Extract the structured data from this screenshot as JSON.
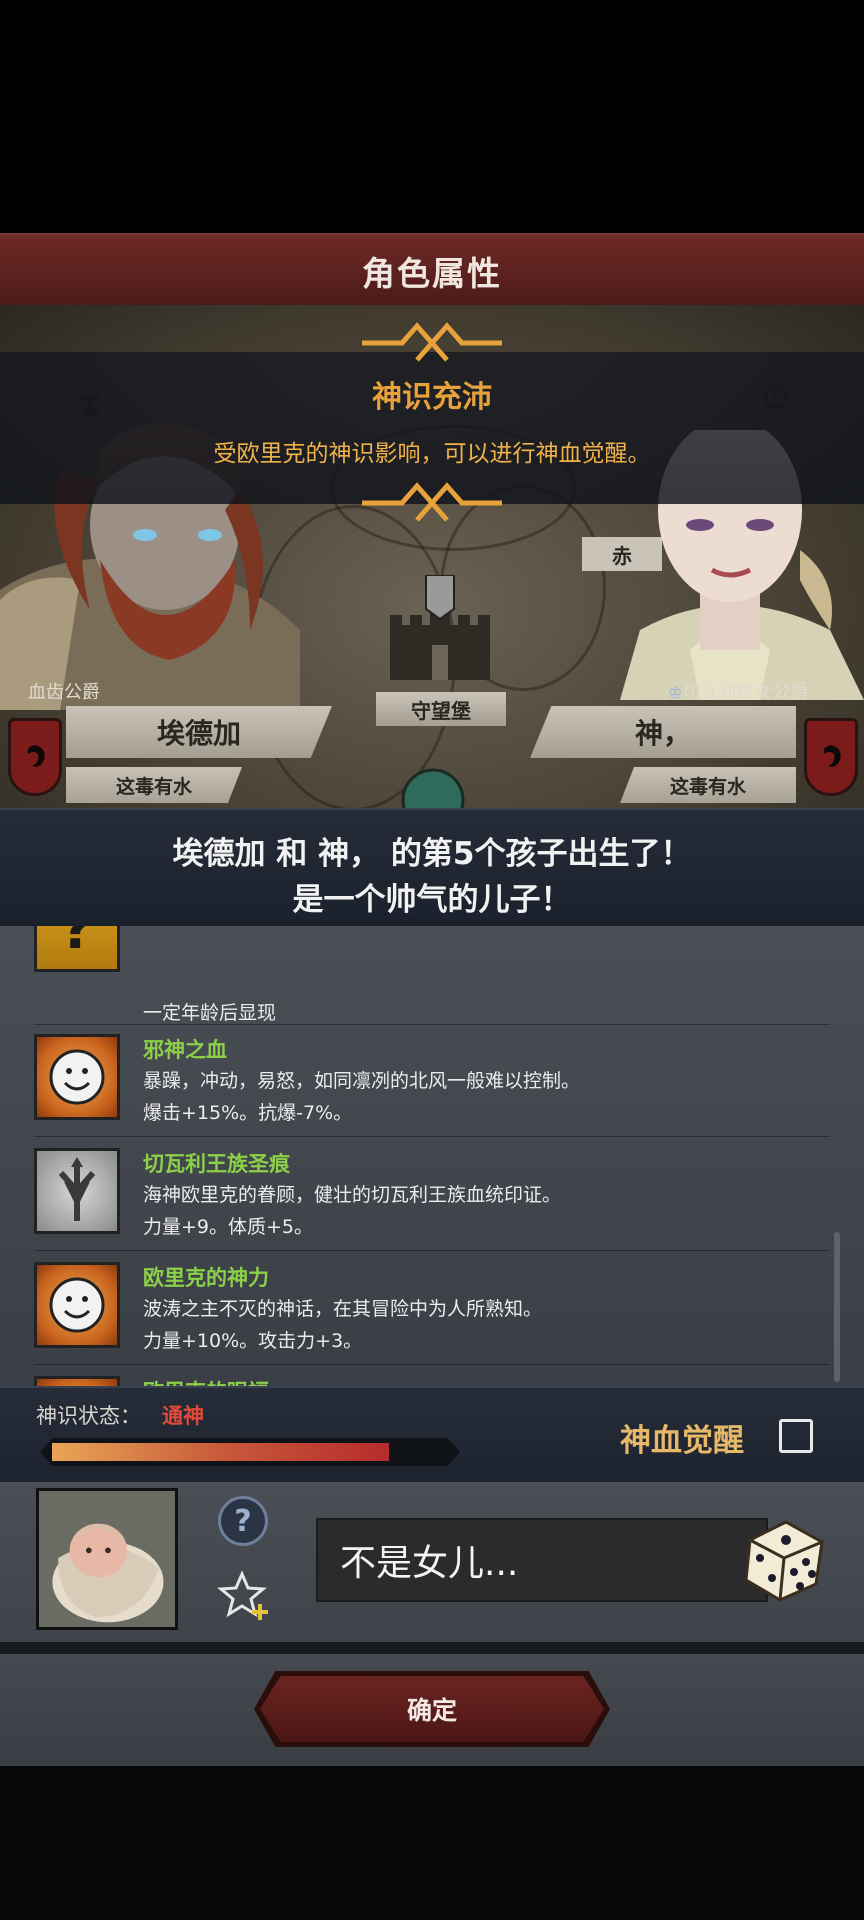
{
  "header": {
    "title": "角色属性"
  },
  "banner": {
    "title": "神识充沛",
    "description": "受欧里克的神识影响，可以进行神血觉醒。"
  },
  "map": {
    "castle_label": "守望堡",
    "partial_label": "赤"
  },
  "father": {
    "title": "血齿公爵",
    "name": "埃德加",
    "status": "这毒有水"
  },
  "mother": {
    "title": "切瓦利赋女公爵",
    "name": "神，",
    "status": "这毒有水"
  },
  "announcement": {
    "line1": "埃德加 和 神， 的第5个孩子出生了！",
    "line2": "是一个帅气的儿子！"
  },
  "traits": [
    {
      "name": "",
      "desc": [
        "一定年龄后显现"
      ],
      "icon": "question-icon"
    },
    {
      "name": "邪神之血",
      "desc": [
        "暴躁，冲动，易怒，如同凛冽的北风一般难以控制。",
        "爆击+15%。抗爆-7%。"
      ],
      "icon": "smiley-icon"
    },
    {
      "name": "切瓦利王族圣痕",
      "desc": [
        "海神欧里克的眷顾，健壮的切瓦利王族血统印证。",
        "力量+9。体质+5。"
      ],
      "icon": "trident-icon"
    },
    {
      "name": "欧里克的神力",
      "desc": [
        "波涛之主不灭的神话，在其冒险中为人所熟知。",
        "力量+10%。攻击力+3。"
      ],
      "icon": "smiley-icon"
    },
    {
      "name": "欧里克的眼福",
      "desc": [],
      "icon": "smiley-icon"
    }
  ],
  "divine": {
    "label": "神识状态：",
    "value": "通神",
    "progress": 0.85,
    "awaken_label": "神血觉醒",
    "awaken_checked": false
  },
  "child": {
    "name_value": "不是女儿..."
  },
  "actions": {
    "confirm": "确定"
  },
  "colors": {
    "accent_gold": "#e8a23c",
    "trait_green": "#8cd04a",
    "status_red": "#e34a3a",
    "button_red": "#6c2421"
  }
}
